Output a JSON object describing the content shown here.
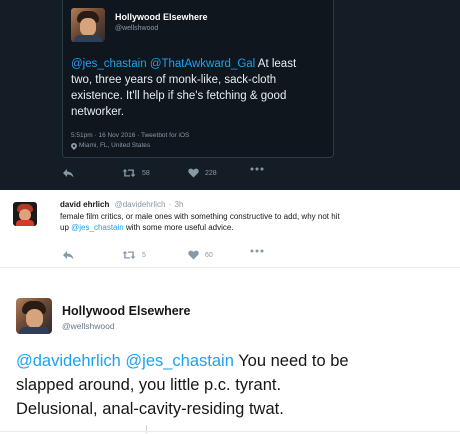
{
  "embedded_tweet": {
    "author_name": "Hollywood Elsewhere",
    "author_handle": "@wellshwood",
    "mention_1": "@jes_chastain",
    "mention_2": "@ThatAwkward_Gal",
    "text_line_1_rest": "At least",
    "text_line_2": "two, three years of monk-like, sack-cloth",
    "text_line_3": "existence.  It'll help if she's fetching & good",
    "text_line_4": "networker.",
    "meta_line_1": "5:51pm · 16 Nov 2016 · Tweetbot for iOS",
    "meta_line_2": "Miami, FL, United States",
    "actions": {
      "retweet_count": "58",
      "like_count": "228"
    },
    "colors": {
      "background": "#141d26",
      "link": "#1da1f2"
    }
  },
  "reply_tweet": {
    "author_name": "david ehrlich",
    "author_handle": "@davidehrlich",
    "separator": "·",
    "time": "3h",
    "text_line_1": "female film critics, or male ones with something constructive to add, why not hit",
    "text_line_2_prefix": "up",
    "mention": "@jes_chastain",
    "text_line_2_rest": "with some more useful advice.",
    "actions": {
      "retweet_count": "5",
      "like_count": "60"
    }
  },
  "main_tweet": {
    "author_name": "Hollywood Elsewhere",
    "author_handle": "@wellshwood",
    "mention_1": "@davidehrlich",
    "mention_2": "@jes_chastain",
    "text_line_1_rest": "You need to be",
    "text_line_2": "slapped around, you little p.c. tyrant.",
    "text_line_3": "Delusional, anal-cavity-residing twat."
  },
  "icons": [
    "reply-icon",
    "retweet-icon",
    "like-icon",
    "more-icon",
    "location-pin-icon"
  ]
}
